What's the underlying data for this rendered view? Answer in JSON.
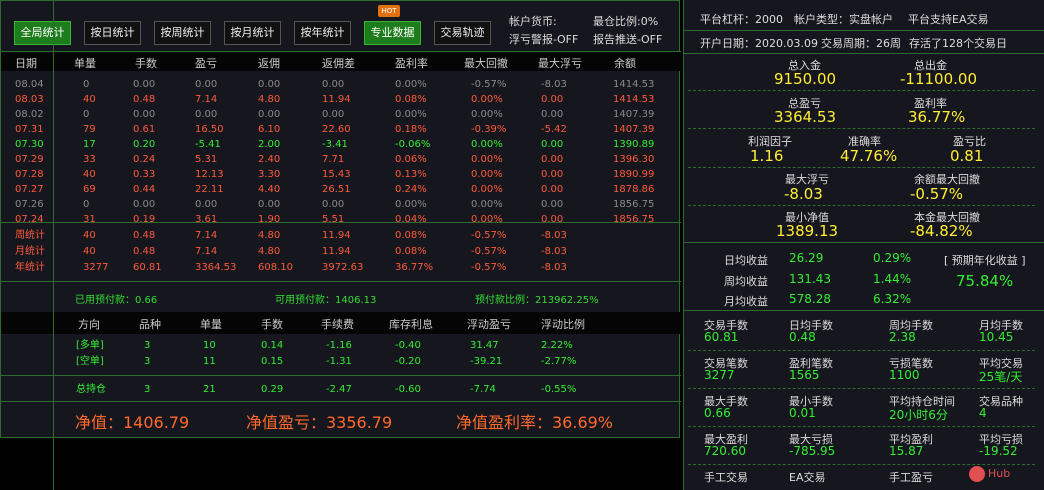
{
  "toolbar": {
    "buttons": [
      "全局统计",
      "按日统计",
      "按周统计",
      "按月统计",
      "按年统计",
      "专业数据",
      "交易轨迹"
    ],
    "hot_badge": "HOT",
    "account_currency": "帐户货币:",
    "warn_settings": "浮亏警报-OFF",
    "max_pos_ratio": "最仓比例:0%",
    "report_push": "报告推送-OFF"
  },
  "table": {
    "headers": [
      "日期",
      "单量",
      "手数",
      "盈亏",
      "返佣",
      "返佣差",
      "盈利率",
      "最大回撤",
      "最大浮亏",
      "余额"
    ],
    "rows": [
      {
        "style": "gray",
        "cells": [
          "08.04",
          "0",
          "0.00",
          "0.00",
          "0.00",
          "0.00",
          "0.00%",
          "-0.57%",
          "-8.03",
          "1414.53"
        ]
      },
      {
        "style": "red",
        "cells": [
          "08.03",
          "40",
          "0.48",
          "7.14",
          "4.80",
          "11.94",
          "0.08%",
          "0.00%",
          "0.00",
          "1414.53"
        ]
      },
      {
        "style": "gray",
        "cells": [
          "08.02",
          "0",
          "0.00",
          "0.00",
          "0.00",
          "0.00",
          "0.00%",
          "0.00%",
          "0.00",
          "1407.39"
        ]
      },
      {
        "style": "red",
        "cells": [
          "07.31",
          "79",
          "0.61",
          "16.50",
          "6.10",
          "22.60",
          "0.18%",
          "-0.39%",
          "-5.42",
          "1407.39"
        ]
      },
      {
        "style": "green",
        "cells": [
          "07.30",
          "17",
          "0.20",
          "-5.41",
          "2.00",
          "-3.41",
          "-0.06%",
          "0.00%",
          "0.00",
          "1390.89"
        ]
      },
      {
        "style": "red",
        "cells": [
          "07.29",
          "33",
          "0.24",
          "5.31",
          "2.40",
          "7.71",
          "0.06%",
          "0.00%",
          "0.00",
          "1396.30"
        ]
      },
      {
        "style": "red",
        "cells": [
          "07.28",
          "40",
          "0.33",
          "12.13",
          "3.30",
          "15.43",
          "0.13%",
          "0.00%",
          "0.00",
          "1890.99"
        ]
      },
      {
        "style": "red",
        "cells": [
          "07.27",
          "69",
          "0.44",
          "22.11",
          "4.40",
          "26.51",
          "0.24%",
          "0.00%",
          "0.00",
          "1878.86"
        ]
      },
      {
        "style": "gray",
        "cells": [
          "07.26",
          "0",
          "0.00",
          "0.00",
          "0.00",
          "0.00",
          "0.00%",
          "0.00%",
          "0.00",
          "1856.75"
        ]
      },
      {
        "style": "red",
        "cells": [
          "07.24",
          "31",
          "0.19",
          "3.61",
          "1.90",
          "5.51",
          "0.04%",
          "0.00%",
          "0.00",
          "1856.75"
        ]
      }
    ],
    "stats": [
      {
        "cells": [
          "周统计",
          "40",
          "0.48",
          "7.14",
          "4.80",
          "11.94",
          "0.08%",
          "-0.57%",
          "-8.03"
        ]
      },
      {
        "cells": [
          "月统计",
          "40",
          "0.48",
          "7.14",
          "4.80",
          "11.94",
          "0.08%",
          "-0.57%",
          "-8.03"
        ]
      },
      {
        "cells": [
          "年统计",
          "3277",
          "60.81",
          "3364.53",
          "608.10",
          "3972.63",
          "36.77%",
          "-0.57%",
          "-8.03"
        ]
      }
    ]
  },
  "margin": {
    "used": "已用预付款：0.66",
    "available": "可用预付款：1406.13",
    "ratio": "预付款比例：213962.25%"
  },
  "positions": {
    "headers": [
      "方向",
      "品种",
      "单量",
      "手数",
      "手续费",
      "库存利息",
      "浮动盈亏",
      "浮动比例"
    ],
    "rows": [
      {
        "cells": [
          "[多单]",
          "3",
          "10",
          "0.14",
          "-1.16",
          "-0.40",
          "31.47",
          "2.22%"
        ]
      },
      {
        "cells": [
          "[空单]",
          "3",
          "11",
          "0.15",
          "-1.31",
          "-0.20",
          "-39.21",
          "-2.77%"
        ]
      }
    ],
    "total": {
      "cells": [
        "总持仓",
        "3",
        "21",
        "0.29",
        "-2.47",
        "-0.60",
        "-7.74",
        "-0.55%"
      ]
    }
  },
  "summary": {
    "net_value": "净值：1406.79",
    "net_profit": "净值盈亏：3356.79",
    "net_rate": "净值盈利率：36.69%"
  },
  "right": {
    "leverage": "平台杠杆：2000",
    "account_type": "帐户类型：实盘帐户",
    "ea_support": "平台支持EA交易",
    "open_date": "开户日期：2020.03.09",
    "period": "交易周期：26周",
    "survived": "存活了128个交易日",
    "deposit_label": "总入金",
    "deposit": "9150.00",
    "withdraw_label": "总出金",
    "withdraw": "-11100.00",
    "profit_label": "总盈亏",
    "profit": "3364.53",
    "rate_label": "盈利率",
    "rate": "36.77%",
    "pf_label": "利润因子",
    "pf": "1.16",
    "acc_label": "准确率",
    "acc": "47.76%",
    "ratio_label": "盈亏比",
    "ratio": "0.81",
    "maxfloat_label": "最大浮亏",
    "maxfloat": "-8.03",
    "maxdd_label": "余额最大回撤",
    "maxdd": "-0.57%",
    "minnet_label": "最小净值",
    "minnet": "1389.13",
    "capdd_label": "本金最大回撤",
    "capdd": "-84.82%",
    "daily_label": "日均收益",
    "daily": "26.29",
    "daily_pct": "0.29%",
    "weekly_label": "周均收益",
    "weekly": "131.43",
    "weekly_pct": "1.44%",
    "monthly_label": "月均收益",
    "monthly": "578.28",
    "monthly_pct": "6.32%",
    "annual_label": "[ 预期年化收益 ]",
    "annual": "75.84%",
    "g1": [
      [
        "交易手数",
        "60.81"
      ],
      [
        "日均手数",
        "0.48"
      ],
      [
        "周均手数",
        "2.38"
      ],
      [
        "月均手数",
        "10.45"
      ]
    ],
    "g2": [
      [
        "交易笔数",
        "3277"
      ],
      [
        "盈利笔数",
        "1565"
      ],
      [
        "亏损笔数",
        "1100"
      ],
      [
        "平均交易",
        "25笔/天"
      ]
    ],
    "g3": [
      [
        "最大手数",
        "0.66"
      ],
      [
        "最小手数",
        "0.01"
      ],
      [
        "平均持仓时间",
        "20小时6分"
      ],
      [
        "交易品种",
        "4"
      ]
    ],
    "g4": [
      [
        "最大盈利",
        "720.60"
      ],
      [
        "最大亏损",
        "-785.95"
      ],
      [
        "平均盈利",
        "15.87"
      ],
      [
        "平均亏损",
        "-19.52"
      ]
    ],
    "g5": [
      [
        "手工交易",
        ""
      ],
      [
        "EA交易",
        ""
      ],
      [
        "手工盈亏",
        ""
      ]
    ]
  },
  "logo": "Hub"
}
